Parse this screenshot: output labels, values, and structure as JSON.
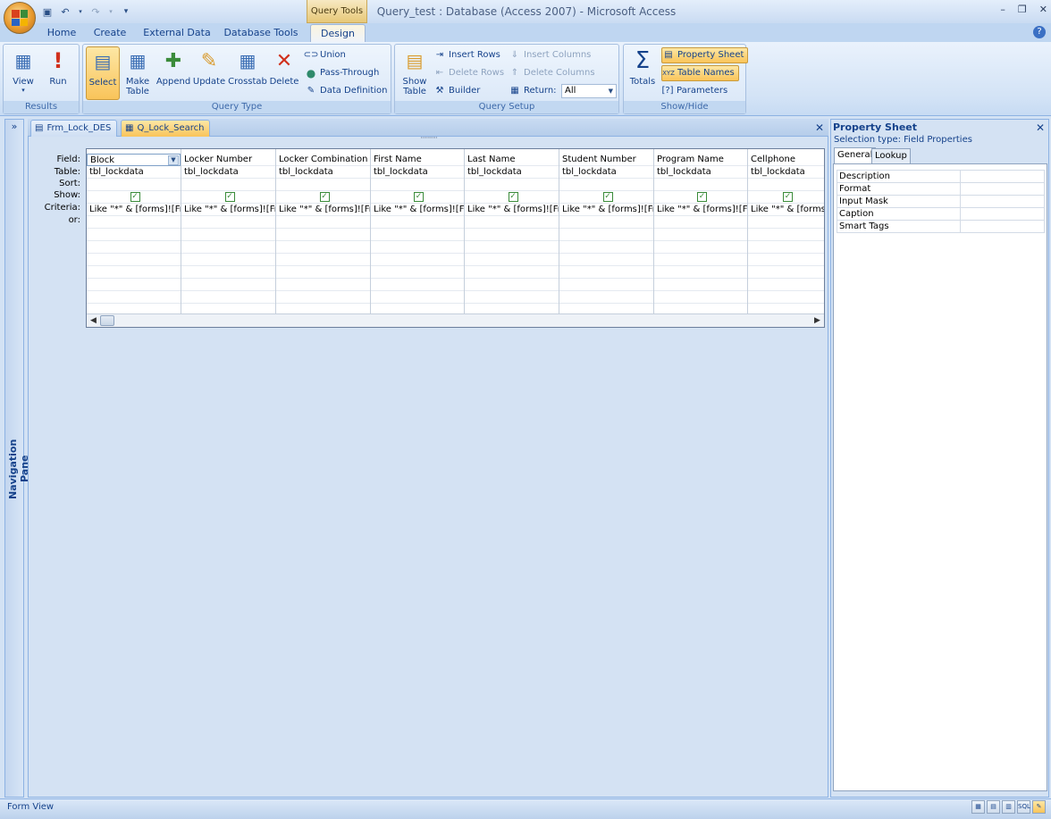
{
  "window": {
    "title": "Query_test : Database (Access 2007) - Microsoft Access",
    "contextual_tab": "Query Tools",
    "minimize": "–",
    "restore": "❐",
    "close": "✕"
  },
  "ribbon_tabs": [
    "Home",
    "Create",
    "External Data",
    "Database Tools",
    "Design"
  ],
  "active_tab": "Design",
  "groups": {
    "results": {
      "label": "Results",
      "view": "View",
      "run": "Run"
    },
    "query_type": {
      "label": "Query Type",
      "select": "Select",
      "make_table_1": "Make",
      "make_table_2": "Table",
      "append": "Append",
      "update": "Update",
      "crosstab": "Crosstab",
      "delete": "Delete",
      "union": "Union",
      "pass_through": "Pass-Through",
      "data_definition": "Data Definition"
    },
    "query_setup": {
      "label": "Query Setup",
      "show_table_1": "Show",
      "show_table_2": "Table",
      "insert_rows": "Insert Rows",
      "delete_rows": "Delete Rows",
      "builder": "Builder",
      "insert_columns": "Insert Columns",
      "delete_columns": "Delete Columns",
      "return_label": "Return:",
      "return_value": "All"
    },
    "show_hide": {
      "label": "Show/Hide",
      "totals": "Totals",
      "property_sheet": "Property Sheet",
      "table_names": "Table Names",
      "parameters": "Parameters"
    }
  },
  "nav_pane": {
    "label": "Navigation Pane",
    "toggle": "»"
  },
  "doc_tabs": [
    {
      "label": "Frm_Lock_DES",
      "selected": false
    },
    {
      "label": "Q_Lock_Search",
      "selected": true
    }
  ],
  "grid": {
    "row_labels": [
      "Field:",
      "Table:",
      "Sort:",
      "Show:",
      "Criteria:",
      "or:"
    ],
    "columns": [
      {
        "field": "Block",
        "table": "tbl_lockdata",
        "criteria": "Like \"*\" & [forms]![Frm"
      },
      {
        "field": "Locker Number",
        "table": "tbl_lockdata",
        "criteria": "Like \"*\" & [forms]![Frm"
      },
      {
        "field": "Locker Combination",
        "table": "tbl_lockdata",
        "criteria": "Like \"*\" & [forms]![Frm"
      },
      {
        "field": "First Name",
        "table": "tbl_lockdata",
        "criteria": "Like \"*\" & [forms]![Frm"
      },
      {
        "field": "Last Name",
        "table": "tbl_lockdata",
        "criteria": "Like \"*\" & [forms]![Frm"
      },
      {
        "field": "Student Number",
        "table": "tbl_lockdata",
        "criteria": "Like \"*\" & [forms]![Frm"
      },
      {
        "field": "Program Name",
        "table": "tbl_lockdata",
        "criteria": "Like \"*\" & [forms]![Frm"
      },
      {
        "field": "Cellphone",
        "table": "tbl_lockdata",
        "criteria": "Like \"*\" & [forms]!["
      }
    ]
  },
  "property_sheet": {
    "title": "Property Sheet",
    "selection_type": "Selection type:  Field Properties",
    "tabs": [
      "General",
      "Lookup"
    ],
    "properties": [
      "Description",
      "Format",
      "Input Mask",
      "Caption",
      "Smart Tags"
    ]
  },
  "status": {
    "text": "Form View",
    "view_buttons": [
      "DS",
      "PV",
      "LV",
      "SQL",
      "DV"
    ]
  }
}
